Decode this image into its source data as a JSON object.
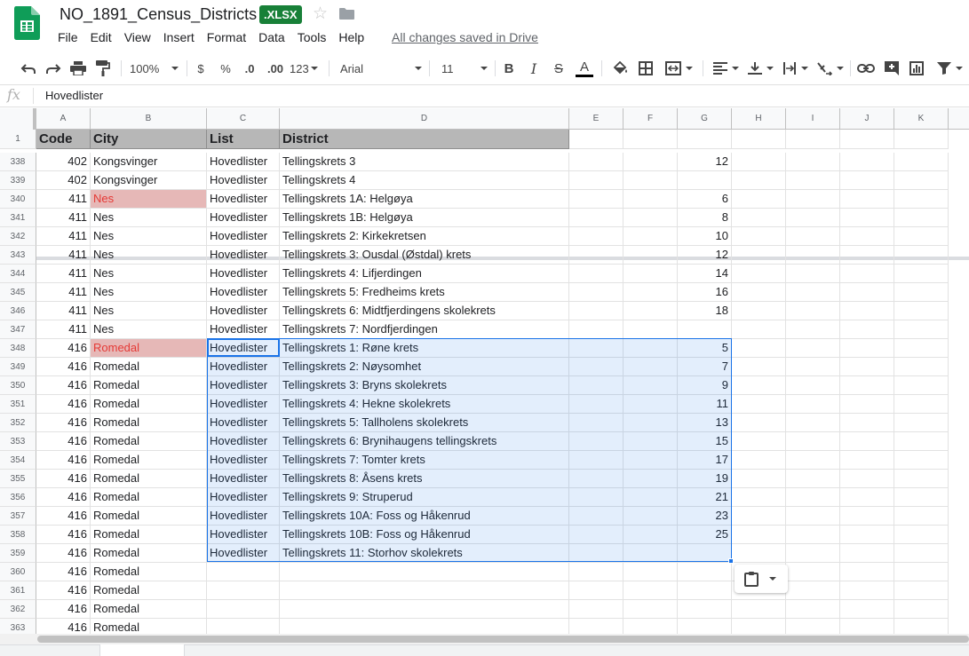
{
  "doc": {
    "title": "NO_1891_Census_Districts",
    "badge": "XLSX",
    "save_status": "All changes saved in Drive"
  },
  "menu": [
    "File",
    "Edit",
    "View",
    "Insert",
    "Format",
    "Data",
    "Tools",
    "Help"
  ],
  "toolbar": {
    "zoom": "100%",
    "currency": "$",
    "percent": "%",
    "decimal_decrease": ".0",
    "decimal_increase": ".00",
    "more_formats": "123",
    "font": "Arial",
    "font_size": "11",
    "bold": "B",
    "italic": "I",
    "strike": "S",
    "text_color": "A"
  },
  "formula_bar": {
    "fx": "fx",
    "value": "Hovedlister"
  },
  "columns": [
    "A",
    "B",
    "C",
    "D",
    "E",
    "F",
    "G",
    "H",
    "I",
    "J",
    "K"
  ],
  "header_row": {
    "num": "1",
    "cells": [
      "Code",
      "City",
      "List",
      "District"
    ]
  },
  "rows": [
    {
      "n": "338",
      "code": "402",
      "city": "Kongsvinger",
      "list": "Hovedlister",
      "district": "Tellingskrets 3",
      "g": "12"
    },
    {
      "n": "339",
      "code": "402",
      "city": "Kongsvinger",
      "list": "Hovedlister",
      "district": "Tellingskrets 4",
      "g": ""
    },
    {
      "n": "340",
      "code": "411",
      "city": "Nes",
      "list": "Hovedlister",
      "district": "Tellingskrets 1A: Helgøya",
      "g": "6",
      "flag": true
    },
    {
      "n": "341",
      "code": "411",
      "city": "Nes",
      "list": "Hovedlister",
      "district": "Tellingskrets 1B: Helgøya",
      "g": "8"
    },
    {
      "n": "342",
      "code": "411",
      "city": "Nes",
      "list": "Hovedlister",
      "district": "Tellingskrets 2: Kirkekretsen",
      "g": "10"
    },
    {
      "n": "343",
      "code": "411",
      "city": "Nes",
      "list": "Hovedlister",
      "district": "Tellingskrets 3: Ousdal (Østdal) krets",
      "g": "12"
    },
    {
      "n": "344",
      "code": "411",
      "city": "Nes",
      "list": "Hovedlister",
      "district": "Tellingskrets 4: Lifjerdingen",
      "g": "14"
    },
    {
      "n": "345",
      "code": "411",
      "city": "Nes",
      "list": "Hovedlister",
      "district": "Tellingskrets 5: Fredheims krets",
      "g": "16"
    },
    {
      "n": "346",
      "code": "411",
      "city": "Nes",
      "list": "Hovedlister",
      "district": "Tellingskrets 6: Midtfjerdingens skolekrets",
      "g": "18"
    },
    {
      "n": "347",
      "code": "411",
      "city": "Nes",
      "list": "Hovedlister",
      "district": "Tellingskrets 7: Nordfjerdingen",
      "g": ""
    },
    {
      "n": "348",
      "code": "416",
      "city": "Romedal",
      "list": "Hovedlister",
      "district": "Tellingskrets 1: Røne krets",
      "g": "5",
      "flag": true
    },
    {
      "n": "349",
      "code": "416",
      "city": "Romedal",
      "list": "Hovedlister",
      "district": "Tellingskrets 2: Nøysomhet",
      "g": "7"
    },
    {
      "n": "350",
      "code": "416",
      "city": "Romedal",
      "list": "Hovedlister",
      "district": "Tellingskrets 3: Bryns skolekrets",
      "g": "9"
    },
    {
      "n": "351",
      "code": "416",
      "city": "Romedal",
      "list": "Hovedlister",
      "district": "Tellingskrets 4: Hekne skolekrets",
      "g": "11"
    },
    {
      "n": "352",
      "code": "416",
      "city": "Romedal",
      "list": "Hovedlister",
      "district": "Tellingskrets 5: Tallholens skolekrets",
      "g": "13"
    },
    {
      "n": "353",
      "code": "416",
      "city": "Romedal",
      "list": "Hovedlister",
      "district": "Tellingskrets 6: Brynihaugens tellingskrets",
      "g": "15"
    },
    {
      "n": "354",
      "code": "416",
      "city": "Romedal",
      "list": "Hovedlister",
      "district": "Tellingskrets 7: Tomter krets",
      "g": "17"
    },
    {
      "n": "355",
      "code": "416",
      "city": "Romedal",
      "list": "Hovedlister",
      "district": "Tellingskrets 8: Åsens krets",
      "g": "19"
    },
    {
      "n": "356",
      "code": "416",
      "city": "Romedal",
      "list": "Hovedlister",
      "district": "Tellingskrets 9: Struperud",
      "g": "21"
    },
    {
      "n": "357",
      "code": "416",
      "city": "Romedal",
      "list": "Hovedlister",
      "district": "Tellingskrets 10A: Foss og Håkenrud",
      "g": "23"
    },
    {
      "n": "358",
      "code": "416",
      "city": "Romedal",
      "list": "Hovedlister",
      "district": "Tellingskrets 10B: Foss og Håkenrud",
      "g": "25"
    },
    {
      "n": "359",
      "code": "416",
      "city": "Romedal",
      "list": "Hovedlister",
      "district": "Tellingskrets 11: Storhov skolekrets",
      "g": ""
    },
    {
      "n": "360",
      "code": "416",
      "city": "Romedal",
      "list": "",
      "district": "",
      "g": ""
    },
    {
      "n": "361",
      "code": "416",
      "city": "Romedal",
      "list": "",
      "district": "",
      "g": ""
    },
    {
      "n": "362",
      "code": "416",
      "city": "Romedal",
      "list": "",
      "district": "",
      "g": ""
    },
    {
      "n": "363",
      "code": "416",
      "city": "Romedal",
      "list": "",
      "district": "",
      "g": ""
    }
  ]
}
